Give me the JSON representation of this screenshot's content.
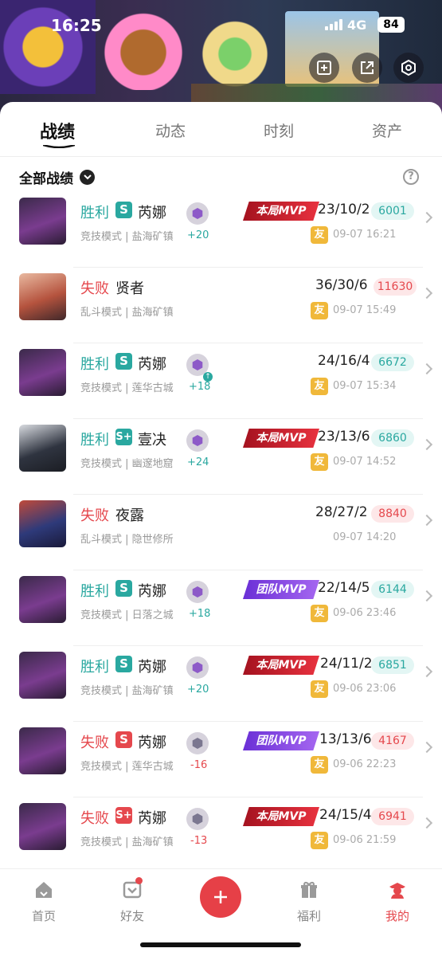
{
  "status": {
    "time": "16:25",
    "network": "4G",
    "battery": "84"
  },
  "tabs": [
    {
      "label": "战绩",
      "active": true
    },
    {
      "label": "动态",
      "active": false
    },
    {
      "label": "时刻",
      "active": false
    },
    {
      "label": "资产",
      "active": false
    }
  ],
  "filter": {
    "label": "全部战绩",
    "help": "?"
  },
  "matches": [
    {
      "result": "胜利",
      "rank": "S",
      "hero": "芮娜",
      "mode": "竞技模式 | 盐海矿镇",
      "delta": "+20",
      "mvp": "本局MVP",
      "kda": "23/10/2",
      "score": "6001",
      "friend": "友",
      "time": "09-07 16:21"
    },
    {
      "result": "失败",
      "rank": "",
      "hero": "贤者",
      "mode": "乱斗模式 | 盐海矿镇",
      "delta": "",
      "mvp": "",
      "kda": "36/30/6",
      "score": "11630",
      "friend": "友",
      "time": "09-07 15:49"
    },
    {
      "result": "胜利",
      "rank": "S",
      "hero": "芮娜",
      "mode": "竞技模式 | 莲华古城",
      "delta": "+18",
      "mvp": "",
      "kda": "24/16/4",
      "score": "6672",
      "friend": "友",
      "time": "09-07 15:34"
    },
    {
      "result": "胜利",
      "rank": "S+",
      "hero": "壹决",
      "mode": "竞技模式 | 幽邃地窟",
      "delta": "+24",
      "mvp": "本局MVP",
      "kda": "23/13/6",
      "score": "6860",
      "friend": "友",
      "time": "09-07 14:52"
    },
    {
      "result": "失败",
      "rank": "",
      "hero": "夜露",
      "mode": "乱斗模式 | 隐世修所",
      "delta": "",
      "mvp": "",
      "kda": "28/27/2",
      "score": "8840",
      "friend": "",
      "time": "09-07 14:20"
    },
    {
      "result": "胜利",
      "rank": "S",
      "hero": "芮娜",
      "mode": "竞技模式 | 日落之城",
      "delta": "+18",
      "mvp": "团队MVP",
      "kda": "22/14/5",
      "score": "6144",
      "friend": "友",
      "time": "09-06 23:46"
    },
    {
      "result": "胜利",
      "rank": "S",
      "hero": "芮娜",
      "mode": "竞技模式 | 盐海矿镇",
      "delta": "+20",
      "mvp": "本局MVP",
      "kda": "24/11/2",
      "score": "6851",
      "friend": "友",
      "time": "09-06 23:06"
    },
    {
      "result": "失败",
      "rank": "S",
      "hero": "芮娜",
      "mode": "竞技模式 | 莲华古城",
      "delta": "-16",
      "mvp": "团队MVP",
      "kda": "13/13/6",
      "score": "4167",
      "friend": "友",
      "time": "09-06 22:23"
    },
    {
      "result": "失败",
      "rank": "S+",
      "hero": "芮娜",
      "mode": "竞技模式 | 盐海矿镇",
      "delta": "-13",
      "mvp": "本局MVP",
      "kda": "24/15/4",
      "score": "6941",
      "friend": "友",
      "time": "09-06 21:59"
    }
  ],
  "nav": [
    {
      "label": "首页",
      "icon": "home-icon"
    },
    {
      "label": "好友",
      "icon": "friends-icon"
    },
    {
      "label": "",
      "icon": "plus-icon"
    },
    {
      "label": "福利",
      "icon": "gift-icon"
    },
    {
      "label": "我的",
      "icon": "profile-icon"
    }
  ],
  "colors": {
    "win": "#2aa8a0",
    "loss": "#e5484d",
    "accent": "#e64047"
  }
}
